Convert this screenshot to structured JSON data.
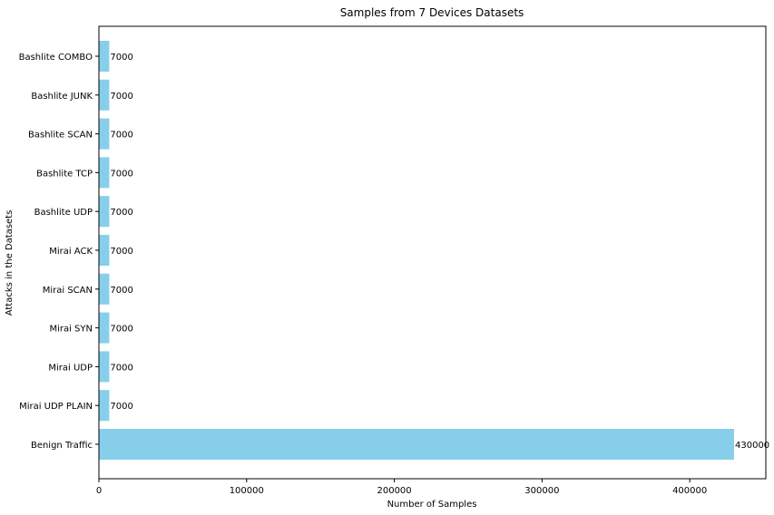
{
  "chart_data": {
    "type": "bar",
    "orientation": "horizontal",
    "title": "Samples from 7 Devices Datasets",
    "xlabel": "Number of Samples",
    "ylabel": "Attacks in the Datasets",
    "categories": [
      "Benign Traffic",
      "Mirai UDP PLAIN",
      "Mirai UDP",
      "Mirai SYN",
      "Mirai SCAN",
      "Mirai ACK",
      "Bashlite UDP",
      "Bashlite TCP",
      "Bashlite SCAN",
      "Bashlite JUNK",
      "Bashlite COMBO"
    ],
    "values": [
      430000,
      7000,
      7000,
      7000,
      7000,
      7000,
      7000,
      7000,
      7000,
      7000,
      7000
    ],
    "data_labels": [
      "430000",
      "7000",
      "7000",
      "7000",
      "7000",
      "7000",
      "7000",
      "7000",
      "7000",
      "7000",
      "7000"
    ],
    "xticks": [
      0,
      100000,
      200000,
      300000,
      400000
    ],
    "xtick_labels": [
      "0",
      "100000",
      "200000",
      "300000",
      "400000"
    ],
    "xlim": [
      0,
      451500
    ],
    "grid": false,
    "bar_color": "#87ceeb"
  }
}
